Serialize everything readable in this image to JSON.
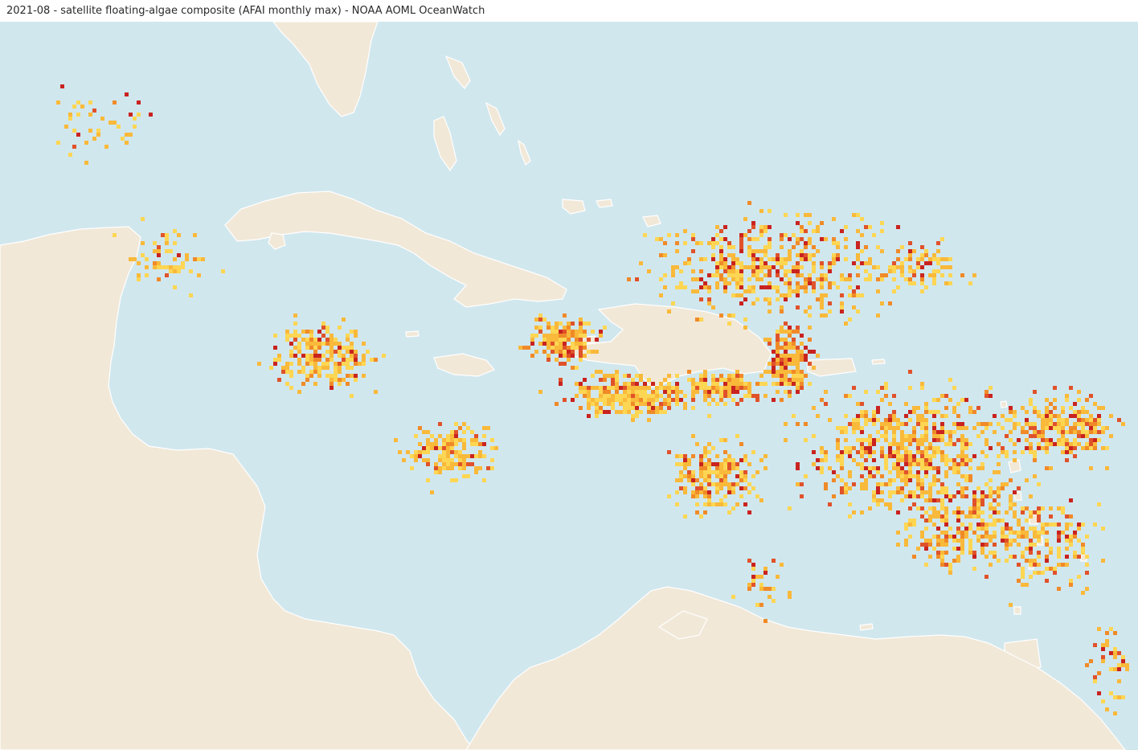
{
  "title": "2021-08 - satellite floating-algae composite (AFAI monthly max) - NOAA AOML OceanWatch",
  "colors": {
    "ocean": "#d1e7ee",
    "land": "#f1e8d8",
    "coast": "#ffffff",
    "density_low": "#fdd653",
    "density_mid_low": "#f9b93a",
    "density_mid": "#f08a28",
    "density_high": "#e0522a",
    "density_max": "#c9231f"
  },
  "icons": {
    "map": "satellite-map"
  }
}
